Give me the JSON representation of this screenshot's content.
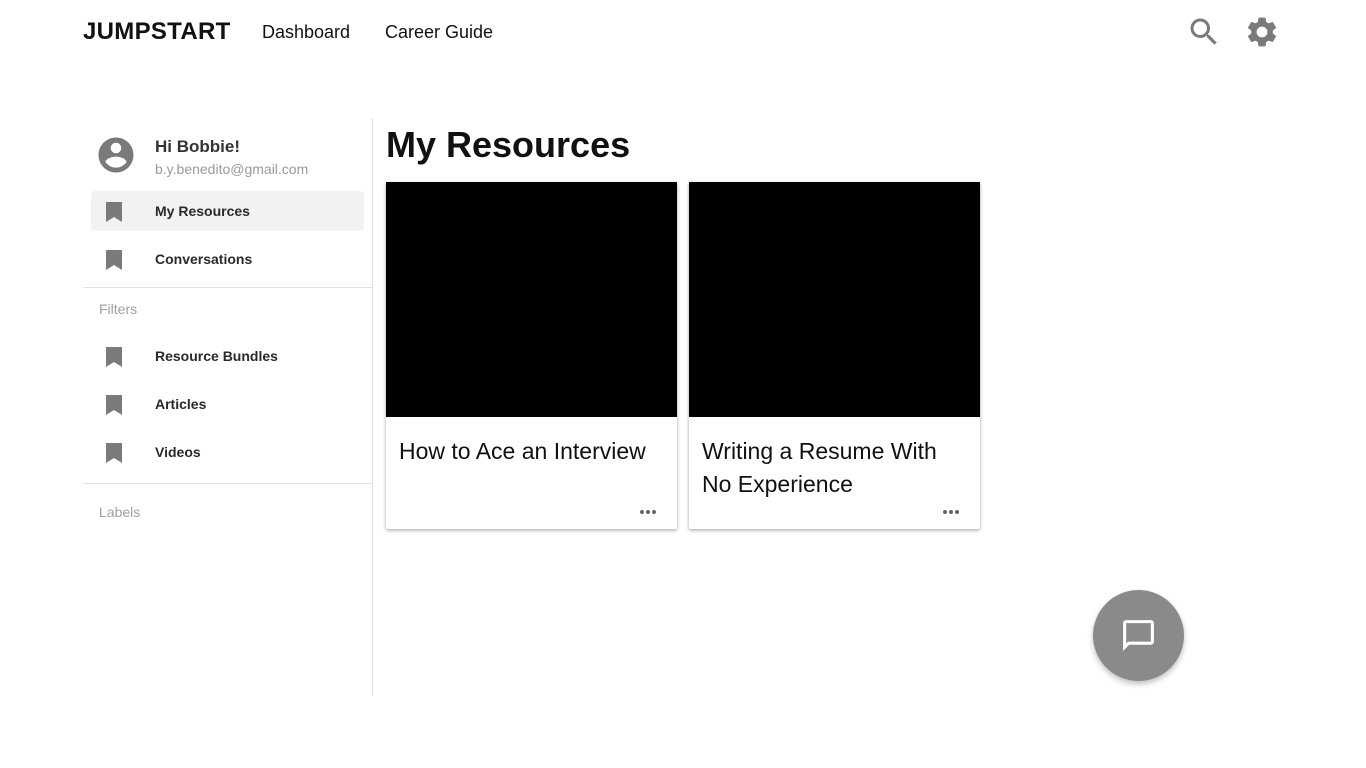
{
  "header": {
    "brand": "JUMPSTART",
    "nav": [
      {
        "label": "Dashboard"
      },
      {
        "label": "Career Guide"
      }
    ],
    "icons": {
      "search": "search-icon",
      "settings": "gear-icon"
    }
  },
  "sidebar": {
    "greeting": "Hi Bobbie!",
    "email": "b.y.benedito@gmail.com",
    "items": [
      {
        "label": "My Resources",
        "icon": "bookmark-icon",
        "active": true
      },
      {
        "label": "Conversations",
        "icon": "bookmark-icon",
        "active": false
      }
    ],
    "filters_label": "Filters",
    "filters": [
      {
        "label": "Resource Bundles",
        "icon": "bookmark-icon"
      },
      {
        "label": "Articles",
        "icon": "bookmark-icon"
      },
      {
        "label": "Videos",
        "icon": "bookmark-icon"
      }
    ],
    "labels_label": "Labels"
  },
  "main": {
    "title": "My Resources",
    "cards": [
      {
        "title": "How to Ace an Interview",
        "menu_icon": "more-horizontal-icon"
      },
      {
        "title": "Writing a Resume With No Experience",
        "menu_icon": "more-horizontal-icon"
      }
    ]
  },
  "fab": {
    "icon": "chat-icon"
  },
  "colors": {
    "icon_gray": "#7a7a7a",
    "fab_bg": "#8a8a8a",
    "active_item_bg": "#f2f2f2",
    "thumbnail": "#000000"
  }
}
